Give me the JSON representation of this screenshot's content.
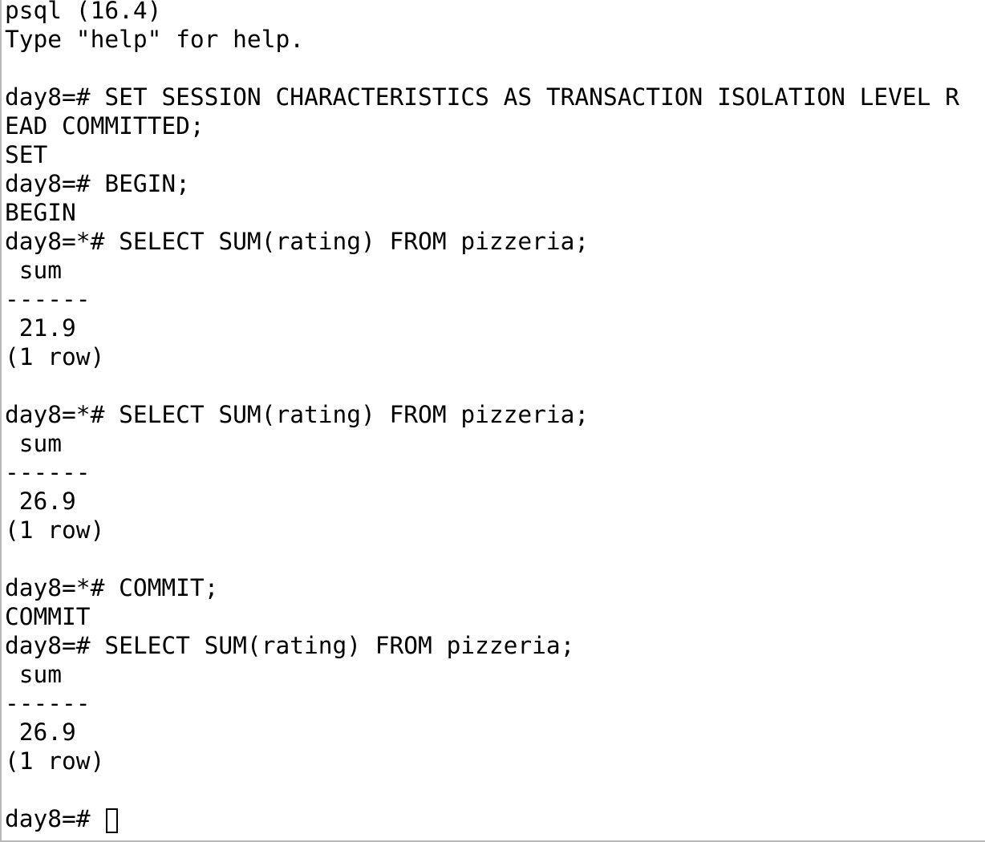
{
  "terminal": {
    "lines": [
      "psql (16.4)",
      "Type \"help\" for help.",
      "",
      "day8=# SET SESSION CHARACTERISTICS AS TRANSACTION ISOLATION LEVEL R",
      "EAD COMMITTED;",
      "SET",
      "day8=# BEGIN;",
      "BEGIN",
      "day8=*# SELECT SUM(rating) FROM pizzeria;",
      " sum",
      "------",
      " 21.9",
      "(1 row)",
      "",
      "day8=*# SELECT SUM(rating) FROM pizzeria;",
      " sum",
      "------",
      " 26.9",
      "(1 row)",
      "",
      "day8=*# COMMIT;",
      "COMMIT",
      "day8=# SELECT SUM(rating) FROM pizzeria;",
      " sum",
      "------",
      " 26.9",
      "(1 row)",
      ""
    ],
    "current_prompt": "day8=# "
  }
}
